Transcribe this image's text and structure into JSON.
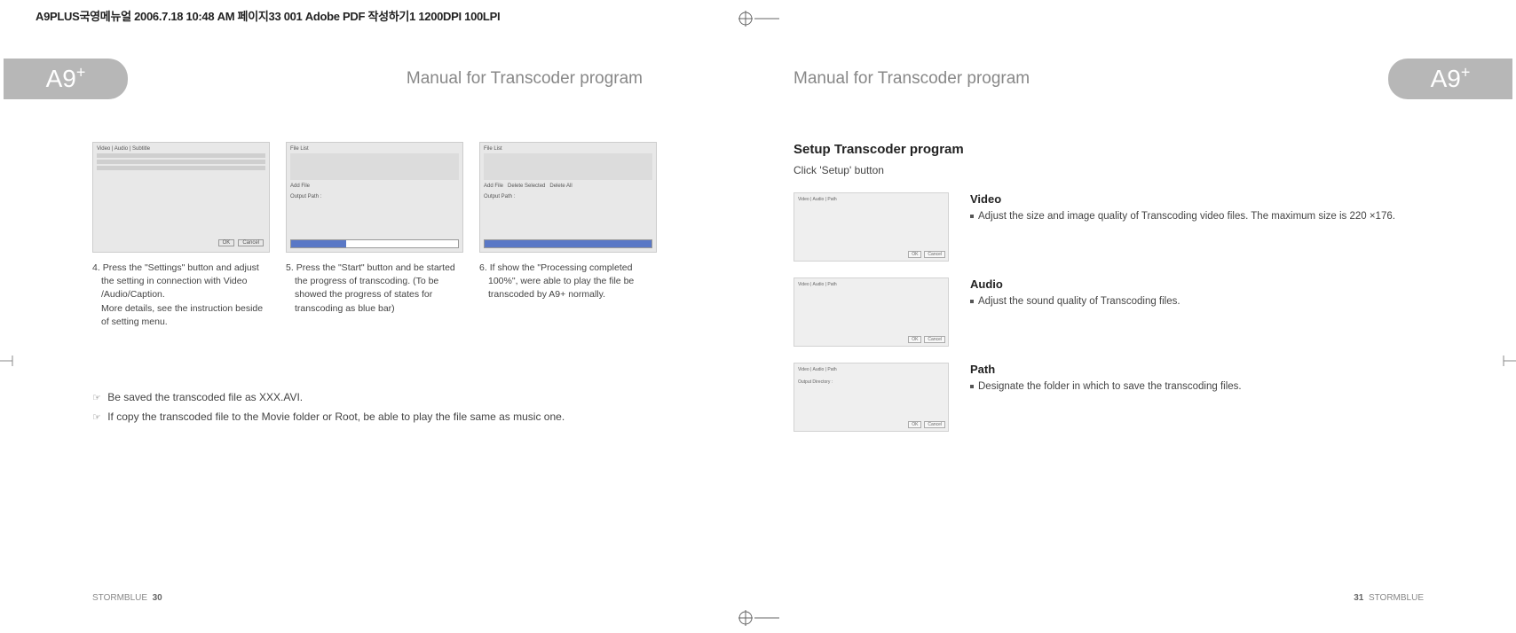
{
  "print_meta": "A9PLUS국영메뉴얼  2006.7.18 10:48 AM  페이지33   001 Adobe PDF 작성하기1 1200DPI 100LPI",
  "model_badge": "A9",
  "model_badge_sup": "+",
  "left_page": {
    "chapter": "Manual for Transcoder program",
    "captions": [
      {
        "num": "4.",
        "text_line1": "Press the \"Settings\" button and adjust",
        "text_line2": "the setting in connection with Video",
        "text_line3": "/Audio/Caption.",
        "text_line4": "More details, see the instruction beside",
        "text_line5": "of setting menu."
      },
      {
        "num": "5.",
        "text_line1": "Press the \"Start\" button and be started",
        "text_line2": "the progress of transcoding. (To be",
        "text_line3": "showed the progress of states for",
        "text_line4": "transcoding as blue bar)",
        "text_line5": ""
      },
      {
        "num": "6.",
        "text_line1": "If show the \"Processing completed",
        "text_line2": "100%\", were able to play the file be",
        "text_line3": "transcoded by A9+ normally.",
        "text_line4": "",
        "text_line5": ""
      }
    ],
    "notes": [
      "Be saved the transcoded file as XXX.AVI.",
      "If copy the transcoded file to the Movie folder or Root, be able to play the file same as music one."
    ],
    "note_marker": "☞",
    "footer_brand": "STORMBLUE",
    "footer_page": "30"
  },
  "right_page": {
    "chapter": "Manual for Transcoder program",
    "setup_heading": "Setup Transcoder program",
    "setup_sub": "Click 'Setup' button",
    "sections": [
      {
        "title": "Video",
        "body": "Adjust the size and image quality of Transcoding video files. The maximum size is 220 ×176."
      },
      {
        "title": "Audio",
        "body": "Adjust the sound quality of Transcoding files."
      },
      {
        "title": "Path",
        "body": "Designate the folder in which to save the transcoding files."
      }
    ],
    "footer_brand": "STORMBLUE",
    "footer_page": "31"
  }
}
